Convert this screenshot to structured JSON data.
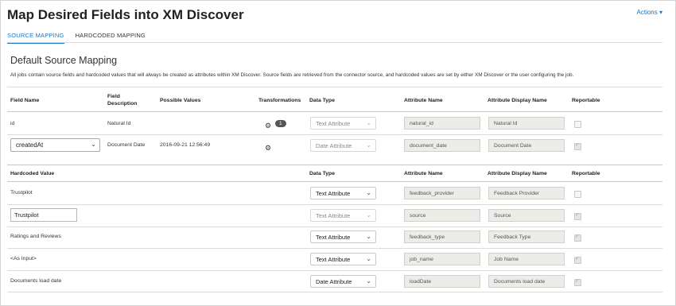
{
  "header": {
    "title": "Map Desired Fields into XM Discover",
    "actions_label": "Actions ▾"
  },
  "tabs": [
    {
      "label": "SOURCE MAPPING",
      "active": true
    },
    {
      "label": "HARDCODED MAPPING",
      "active": false
    }
  ],
  "section": {
    "title": "Default Source Mapping",
    "description": "All jobs contain source fields and hardcoded values that will always be created as attributes within XM Discover. Source fields are retrieved from the connector source, and hardcoded values are set by either XM Discover or the user configuring the job."
  },
  "source_table": {
    "headers": {
      "field_name": "Field Name",
      "field_description": "Field\nDescription",
      "possible_values": "Possible Values",
      "transformations": "Transformations",
      "data_type": "Data Type",
      "attribute_name": "Attribute Name",
      "attribute_display_name": "Attribute Display Name",
      "reportable": "Reportable"
    },
    "rows": [
      {
        "field_name": "id",
        "field_description": "Natural Id",
        "possible_values": "",
        "transform_count": "1",
        "data_type": "Text Attribute",
        "attribute_name": "natural_id",
        "attribute_display_name": "Natural Id",
        "reportable": false
      },
      {
        "field_name": "createdAt",
        "field_description": "Document Date",
        "possible_values": "2016-09-21 12:56:49",
        "transform_count": "",
        "data_type": "Date Attribute",
        "attribute_name": "document_date",
        "attribute_display_name": "Document Date",
        "reportable": true
      }
    ]
  },
  "hardcoded_table": {
    "headers": {
      "hardcoded_value": "Hardcoded Value",
      "data_type": "Data Type",
      "attribute_name": "Attribute Name",
      "attribute_display_name": "Attribute Display Name",
      "reportable": "Reportable"
    },
    "rows": [
      {
        "value": "Trustpilot",
        "editable": false,
        "data_type": "Text Attribute",
        "type_enabled": true,
        "attribute_name": "feedback_provider",
        "attribute_display_name": "Feedback Provider",
        "reportable": false
      },
      {
        "value": "Trustpilot",
        "editable": true,
        "data_type": "Text Attribute",
        "type_enabled": false,
        "attribute_name": "source",
        "attribute_display_name": "Source",
        "reportable": true
      },
      {
        "value": "Ratings and Reviews",
        "editable": false,
        "data_type": "Text Attribute",
        "type_enabled": true,
        "attribute_name": "feedback_type",
        "attribute_display_name": "Feedback Type",
        "reportable": true
      },
      {
        "value": "<As Input>",
        "editable": false,
        "data_type": "Text Attribute",
        "type_enabled": true,
        "attribute_name": "job_name",
        "attribute_display_name": "Job Name",
        "reportable": true
      },
      {
        "value": "Documents load date",
        "editable": false,
        "data_type": "Date Attribute",
        "type_enabled": true,
        "attribute_name": "loadDate",
        "attribute_display_name": "Documents load date",
        "reportable": true
      }
    ]
  },
  "icons": {
    "gear": "gear-icon",
    "chevron": "chevron-down-icon"
  }
}
